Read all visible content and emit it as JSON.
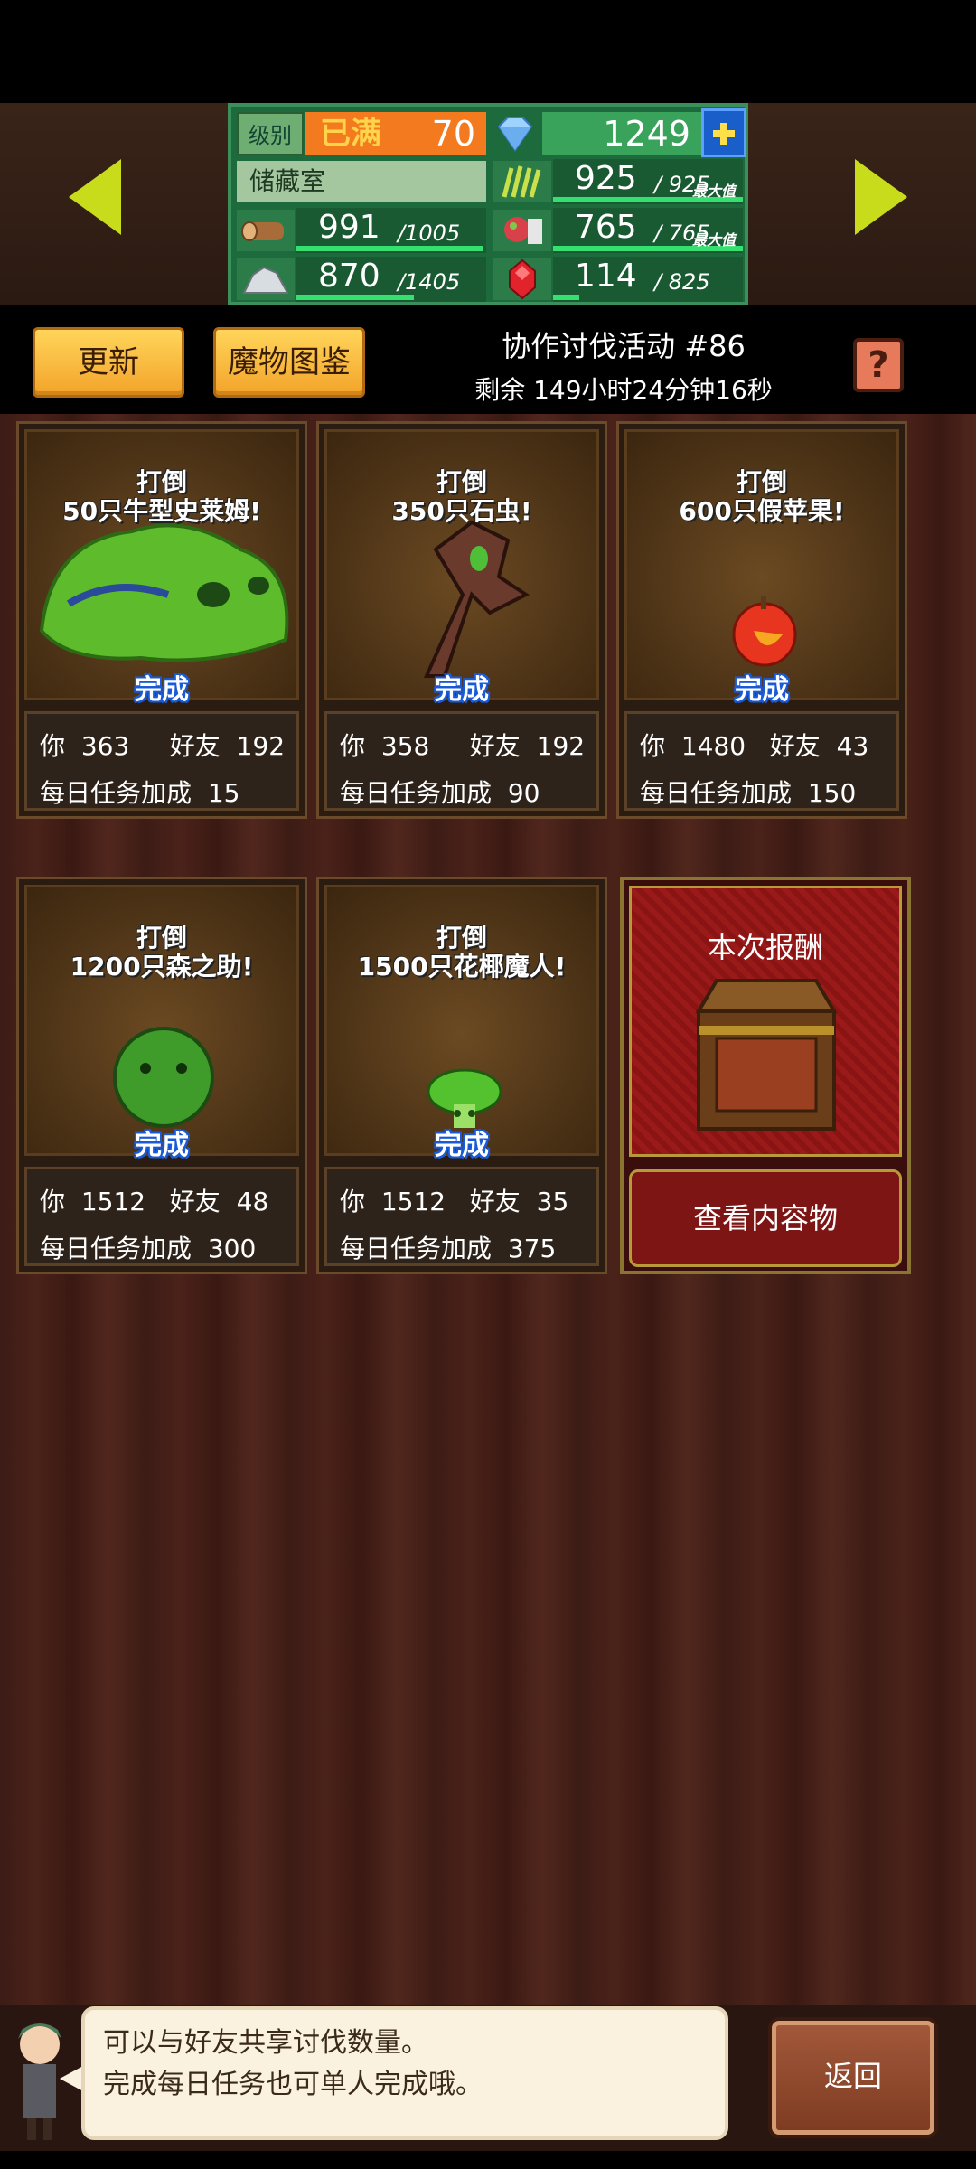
{
  "header": {
    "level_label": "级别",
    "level_status": "已满",
    "level_value": "70",
    "gems": "1249",
    "storage_label": "储藏室",
    "resources": [
      {
        "name": "wood",
        "icon": "wood-log-icon",
        "value": "991",
        "max": "/1005",
        "fill": 0.986,
        "max_tag": ""
      },
      {
        "name": "stone",
        "icon": "stone-icon",
        "value": "870",
        "max": "/1405",
        "fill": 0.619,
        "max_tag": ""
      },
      {
        "name": "grass",
        "icon": "grass-icon",
        "value": "925",
        "max": "/ 925",
        "fill": 1.0,
        "max_tag": "最大值"
      },
      {
        "name": "food",
        "icon": "meat-food-icon",
        "value": "765",
        "max": "/ 765",
        "fill": 1.0,
        "max_tag": "最大值"
      },
      {
        "name": "ruby",
        "icon": "red-gem-icon",
        "value": "114",
        "max": "/ 825",
        "fill": 0.138,
        "max_tag": ""
      }
    ]
  },
  "toolbar": {
    "update_label": "更新",
    "bestiary_label": "魔物图鉴",
    "help_label": "?"
  },
  "event": {
    "title": "协作讨伐活动 #86",
    "remaining": "剩余 149小时24分钟16秒"
  },
  "quests": [
    {
      "title_line1": "打倒",
      "title_line2": "50只牛型史莱姆!",
      "status": "完成",
      "you_label": "你",
      "you": "363",
      "friend_label": "好友",
      "friend": "192",
      "bonus_label": "每日任务加成",
      "bonus": "15",
      "monster": "green-slime"
    },
    {
      "title_line1": "打倒",
      "title_line2": "350只石虫!",
      "status": "完成",
      "you_label": "你",
      "you": "358",
      "friend_label": "好友",
      "friend": "192",
      "bonus_label": "每日任务加成",
      "bonus": "90",
      "monster": "stone-worm"
    },
    {
      "title_line1": "打倒",
      "title_line2": "600只假苹果!",
      "status": "完成",
      "you_label": "你",
      "you": "1480",
      "friend_label": "好友",
      "friend": "43",
      "bonus_label": "每日任务加成",
      "bonus": "150",
      "monster": "fake-apple"
    },
    {
      "title_line1": "打倒",
      "title_line2": "1200只森之助!",
      "status": "完成",
      "you_label": "你",
      "you": "1512",
      "friend_label": "好友",
      "friend": "48",
      "bonus_label": "每日任务加成",
      "bonus": "300",
      "monster": "forest-bush"
    },
    {
      "title_line1": "打倒",
      "title_line2": "1500只花椰魔人!",
      "status": "完成",
      "you_label": "你",
      "you": "1512",
      "friend_label": "好友",
      "friend": "35",
      "bonus_label": "每日任务加成",
      "bonus": "375",
      "monster": "broccoli"
    }
  ],
  "reward": {
    "title": "本次报酬",
    "button_label": "查看内容物"
  },
  "footer": {
    "message_line1": "可以与好友共享讨伐数量。",
    "message_line2": "完成每日任务也可单人完成哦。",
    "back_label": "返回"
  }
}
